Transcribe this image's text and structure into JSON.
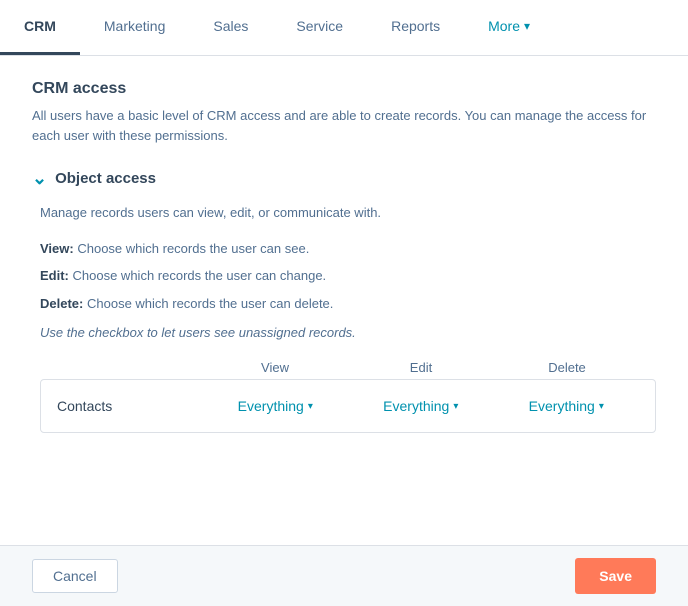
{
  "tabs": [
    {
      "id": "crm",
      "label": "CRM",
      "active": true
    },
    {
      "id": "marketing",
      "label": "Marketing",
      "active": false
    },
    {
      "id": "sales",
      "label": "Sales",
      "active": false
    },
    {
      "id": "service",
      "label": "Service",
      "active": false
    },
    {
      "id": "reports",
      "label": "Reports",
      "active": false
    },
    {
      "id": "more",
      "label": "More",
      "active": false,
      "hasDropdown": true
    }
  ],
  "crm_access": {
    "title": "CRM access",
    "description": "All users have a basic level of CRM access and are able to create records. You can manage the access for each user with these permissions."
  },
  "object_access": {
    "section_title": "Object access",
    "description": "Manage records users can view, edit, or communicate with.",
    "view_label": "View:",
    "view_desc": "Choose which records the user can see.",
    "edit_label": "Edit:",
    "edit_desc": "Choose which records the user can change.",
    "delete_label": "Delete:",
    "delete_desc": "Choose which records the user can delete.",
    "italic_note": "Use the checkbox to let users see unassigned records."
  },
  "table": {
    "columns": [
      "",
      "View",
      "Edit",
      "Delete"
    ],
    "rows": [
      {
        "name": "Contacts",
        "view": "Everything",
        "edit": "Everything",
        "delete": "Everything"
      }
    ]
  },
  "footer": {
    "cancel_label": "Cancel",
    "save_label": "Save"
  }
}
